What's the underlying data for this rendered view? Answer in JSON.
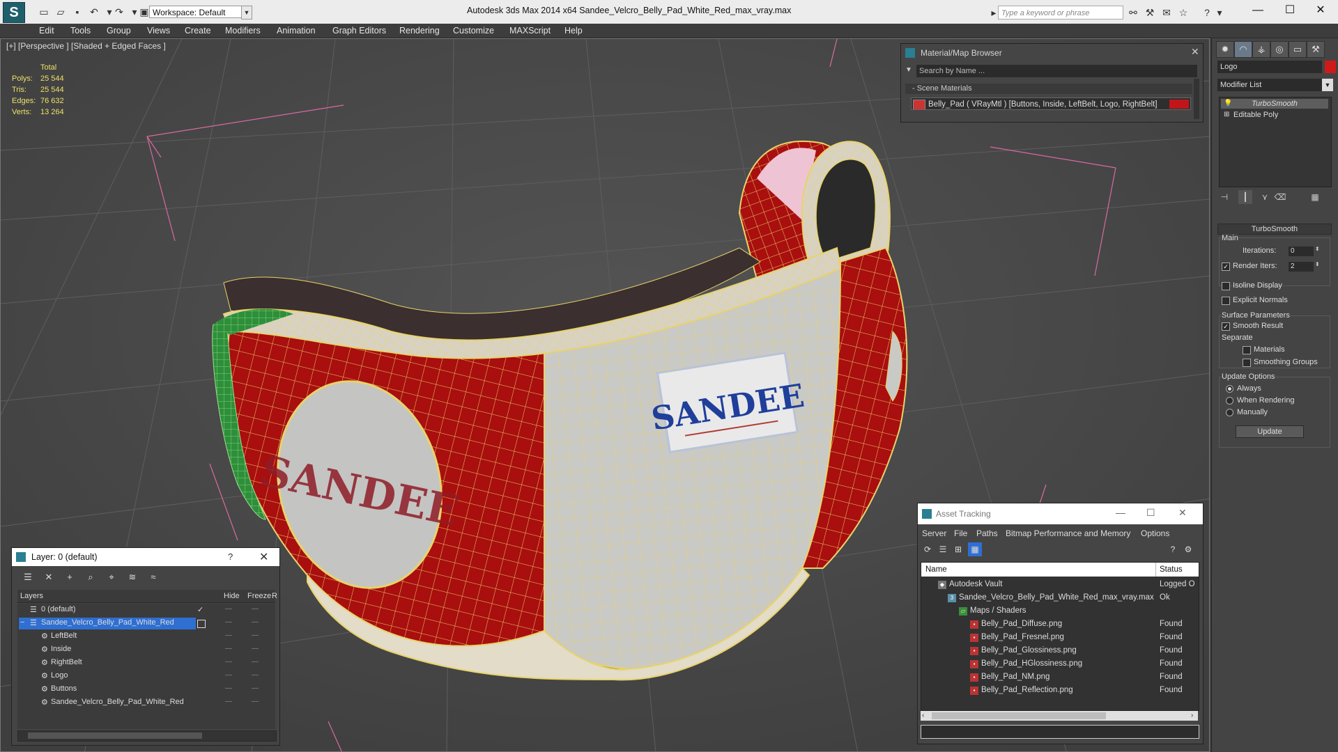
{
  "app": {
    "title": "Autodesk 3ds Max  2014 x64     Sandee_Velcro_Belly_Pad_White_Red_max_vray.max",
    "workspace": "Workspace: Default",
    "search_placeholder": "Type a keyword or phrase"
  },
  "menu": [
    "Edit",
    "Tools",
    "Group",
    "Views",
    "Create",
    "Modifiers",
    "Animation",
    "Graph Editors",
    "Rendering",
    "Customize",
    "MAXScript",
    "Help"
  ],
  "viewport": {
    "label": "[+] [Perspective ] [Shaded + Edged Faces ]",
    "stats": {
      "header": "Total",
      "rows": [
        {
          "label": "Polys:",
          "value": "25 544"
        },
        {
          "label": "Tris:",
          "value": "25 544"
        },
        {
          "label": "Edges:",
          "value": "76 632"
        },
        {
          "label": "Verts:",
          "value": "13 264"
        }
      ]
    },
    "logo_front": "SANDEE",
    "logo_side": "SANDEE"
  },
  "material_browser": {
    "title": "Material/Map Browser",
    "search": "Search by Name ...",
    "section": "- Scene Materials",
    "item": "Belly_Pad  ( VRayMtl ) [Buttons, Inside, LeftBelt, Logo, RightBelt]"
  },
  "command_panel": {
    "object_name": "Logo",
    "object_color": "#d01a1a",
    "modifier_list": "Modifier List",
    "stack": [
      "TurboSmooth",
      "Editable Poly"
    ],
    "turbosmooth": {
      "title": "TurboSmooth",
      "main_label": "Main",
      "iterations_label": "Iterations:",
      "iterations_value": "0",
      "render_iters_label": "Render Iters:",
      "render_iters_value": "2",
      "render_iters_checked": true,
      "isoline": "Isoline Display",
      "explicit": "Explicit Normals",
      "surface_params": "Surface Parameters",
      "smooth_result": "Smooth Result",
      "smooth_checked": true,
      "separate": "Separate",
      "materials": "Materials",
      "smoothing_groups": "Smoothing Groups",
      "update_options": "Update Options",
      "always": "Always",
      "when_rendering": "When Rendering",
      "manually": "Manually",
      "update_button": "Update"
    }
  },
  "layer_dialog": {
    "title": "Layer: 0 (default)",
    "help": "?",
    "columns": {
      "layers": "Layers",
      "hide": "Hide",
      "freeze": "Freeze",
      "r": "R"
    },
    "rows": [
      {
        "name": "0 (default)",
        "indent": 0,
        "selected": false,
        "checked": true
      },
      {
        "name": "Sandee_Velcro_Belly_Pad_White_Red",
        "indent": 0,
        "selected": true,
        "checked": false
      },
      {
        "name": "LeftBelt",
        "indent": 1,
        "selected": false,
        "checked": false
      },
      {
        "name": "Inside",
        "indent": 1,
        "selected": false,
        "checked": false
      },
      {
        "name": "RightBelt",
        "indent": 1,
        "selected": false,
        "checked": false
      },
      {
        "name": "Logo",
        "indent": 1,
        "selected": false,
        "checked": false
      },
      {
        "name": "Buttons",
        "indent": 1,
        "selected": false,
        "checked": false
      },
      {
        "name": "Sandee_Velcro_Belly_Pad_White_Red",
        "indent": 1,
        "selected": false,
        "checked": false
      }
    ]
  },
  "asset_tracking": {
    "title": "Asset Tracking",
    "menu": [
      "Server",
      "File",
      "Paths",
      "Bitmap Performance and Memory",
      "Options"
    ],
    "columns": {
      "name": "Name",
      "status": "Status"
    },
    "rows": [
      {
        "name": "Autodesk Vault",
        "status": "Logged O",
        "indent": 0,
        "icon": "vault"
      },
      {
        "name": "Sandee_Velcro_Belly_Pad_White_Red_max_vray.max",
        "status": "Ok",
        "indent": 1,
        "icon": "max"
      },
      {
        "name": "Maps / Shaders",
        "status": "",
        "indent": 2,
        "icon": "folder"
      },
      {
        "name": "Belly_Pad_Diffuse.png",
        "status": "Found",
        "indent": 3,
        "icon": "png"
      },
      {
        "name": "Belly_Pad_Fresnel.png",
        "status": "Found",
        "indent": 3,
        "icon": "png"
      },
      {
        "name": "Belly_Pad_Glossiness.png",
        "status": "Found",
        "indent": 3,
        "icon": "png"
      },
      {
        "name": "Belly_Pad_HGlossiness.png",
        "status": "Found",
        "indent": 3,
        "icon": "png"
      },
      {
        "name": "Belly_Pad_NM.png",
        "status": "Found",
        "indent": 3,
        "icon": "png"
      },
      {
        "name": "Belly_Pad_Reflection.png",
        "status": "Found",
        "indent": 3,
        "icon": "png"
      }
    ]
  },
  "colors": {
    "pad_red": "#a90f0f",
    "pad_white": "#c9c9c6",
    "wire_yellow": "#e8d36a",
    "trim_green": "#2e8f3a",
    "selection_blue": "#2f6fd1"
  }
}
